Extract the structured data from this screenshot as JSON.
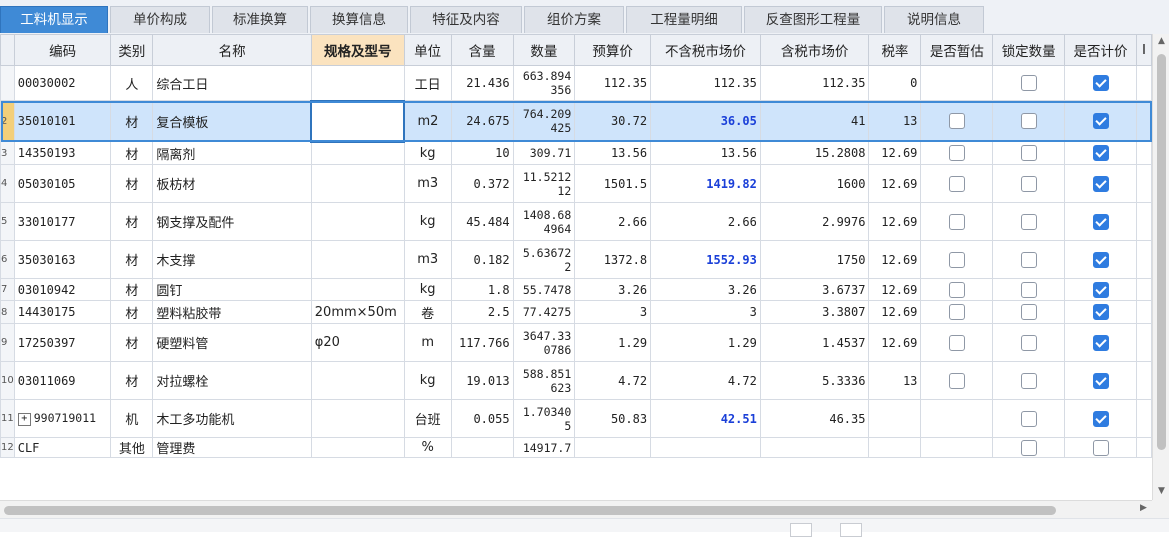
{
  "tabs": [
    {
      "label": "工料机显示",
      "active": true
    },
    {
      "label": "单价构成"
    },
    {
      "label": "标准换算"
    },
    {
      "label": "换算信息"
    },
    {
      "label": "特征及内容"
    },
    {
      "label": "组价方案"
    },
    {
      "label": "工程量明细"
    },
    {
      "label": "反查图形工程量"
    },
    {
      "label": "说明信息"
    }
  ],
  "columns": {
    "code": "编码",
    "type": "类别",
    "name": "名称",
    "spec": "规格及型号",
    "unit": "单位",
    "content": "含量",
    "qty": "数量",
    "budget": "预算价",
    "market_ex": "不含税市场价",
    "market_in": "含税市场价",
    "tax": "税率",
    "provisional": "是否暂估",
    "lock_qty": "锁定数量",
    "priced": "是否计价",
    "more": "I"
  },
  "rows": [
    {
      "rn": "",
      "code": "00030002",
      "type": "人",
      "name": "综合工日",
      "spec": "",
      "unit": "工日",
      "content": "21.436",
      "qty": "663.894356",
      "budget": "112.35",
      "market_ex": "112.35",
      "market_in": "112.35",
      "tax": "0",
      "provisional": null,
      "lock_qty": false,
      "priced": true
    },
    {
      "rn": "2",
      "code": "35010101",
      "type": "材",
      "name": "复合模板",
      "spec": "",
      "unit": "m2",
      "content": "24.675",
      "qty": "764.209425",
      "budget": "30.72",
      "market_ex": "36.05",
      "market_in": "41",
      "tax": "13",
      "provisional": false,
      "lock_qty": false,
      "priced": true
    },
    {
      "rn": "3",
      "code": "14350193",
      "type": "材",
      "name": "隔离剂",
      "spec": "",
      "unit": "kg",
      "content": "10",
      "qty": "309.71",
      "budget": "13.56",
      "market_ex": "13.56",
      "market_in": "15.2808",
      "tax": "12.69",
      "provisional": false,
      "lock_qty": false,
      "priced": true
    },
    {
      "rn": "4",
      "code": "05030105",
      "type": "材",
      "name": "板枋材",
      "spec": "",
      "unit": "m3",
      "content": "0.372",
      "qty": "11.521212",
      "budget": "1501.5",
      "market_ex": "1419.82",
      "market_in": "1600",
      "tax": "12.69",
      "provisional": false,
      "lock_qty": false,
      "priced": true
    },
    {
      "rn": "5",
      "code": "33010177",
      "type": "材",
      "name": "钢支撑及配件",
      "spec": "",
      "unit": "kg",
      "content": "45.484",
      "qty": "1408.684964",
      "budget": "2.66",
      "market_ex": "2.66",
      "market_in": "2.9976",
      "tax": "12.69",
      "provisional": false,
      "lock_qty": false,
      "priced": true
    },
    {
      "rn": "6",
      "code": "35030163",
      "type": "材",
      "name": "木支撑",
      "spec": "",
      "unit": "m3",
      "content": "0.182",
      "qty": "5.636722",
      "budget": "1372.8",
      "market_ex": "1552.93",
      "market_in": "1750",
      "tax": "12.69",
      "provisional": false,
      "lock_qty": false,
      "priced": true
    },
    {
      "rn": "7",
      "code": "03010942",
      "type": "材",
      "name": "圆钉",
      "spec": "",
      "unit": "kg",
      "content": "1.8",
      "qty": "55.7478",
      "budget": "3.26",
      "market_ex": "3.26",
      "market_in": "3.6737",
      "tax": "12.69",
      "provisional": false,
      "lock_qty": false,
      "priced": true
    },
    {
      "rn": "8",
      "code": "14430175",
      "type": "材",
      "name": "塑料粘胶带",
      "spec": "20mm×50m",
      "unit": "卷",
      "content": "2.5",
      "qty": "77.4275",
      "budget": "3",
      "market_ex": "3",
      "market_in": "3.3807",
      "tax": "12.69",
      "provisional": false,
      "lock_qty": false,
      "priced": true
    },
    {
      "rn": "9",
      "code": "17250397",
      "type": "材",
      "name": "硬塑料管",
      "spec": "φ20",
      "unit": "m",
      "content": "117.766",
      "qty": "3647.330786",
      "budget": "1.29",
      "market_ex": "1.29",
      "market_in": "1.4537",
      "tax": "12.69",
      "provisional": false,
      "lock_qty": false,
      "priced": true
    },
    {
      "rn": "10",
      "code": "03011069",
      "type": "材",
      "name": "对拉螺栓",
      "spec": "",
      "unit": "kg",
      "content": "19.013",
      "qty": "588.851623",
      "budget": "4.72",
      "market_ex": "4.72",
      "market_in": "5.3336",
      "tax": "13",
      "provisional": false,
      "lock_qty": false,
      "priced": true
    },
    {
      "rn": "11",
      "code": "990719011",
      "type": "机",
      "name": "木工多功能机",
      "spec": "",
      "unit": "台班",
      "content": "0.055",
      "qty": "1.703405",
      "budget": "50.83",
      "market_ex": "42.51",
      "market_in": "46.35",
      "tax": "",
      "provisional": null,
      "lock_qty": false,
      "priced": true,
      "expander": "+"
    },
    {
      "rn": "12",
      "code": "CLF",
      "type": "其他",
      "name": "管理费",
      "spec": "",
      "unit": "%",
      "content": "",
      "qty": "14917.7",
      "budget": "",
      "market_ex": "",
      "market_in": "",
      "tax": "",
      "provisional": null,
      "lock_qty": false,
      "priced": false
    }
  ],
  "blue_market_ex_rows": [
    1,
    3,
    5,
    10
  ],
  "selected_row_index": 1,
  "colors": {
    "tab_active": "#3f8ad6",
    "selected_row": "#cfe4fb",
    "highlight_header": "#fbe3bf",
    "blue_text": "#1a3fd8",
    "checkbox_on": "#2f7ce0"
  },
  "icons": {
    "checkbox": "checkbox-icon",
    "expand": "plus-square-icon"
  }
}
